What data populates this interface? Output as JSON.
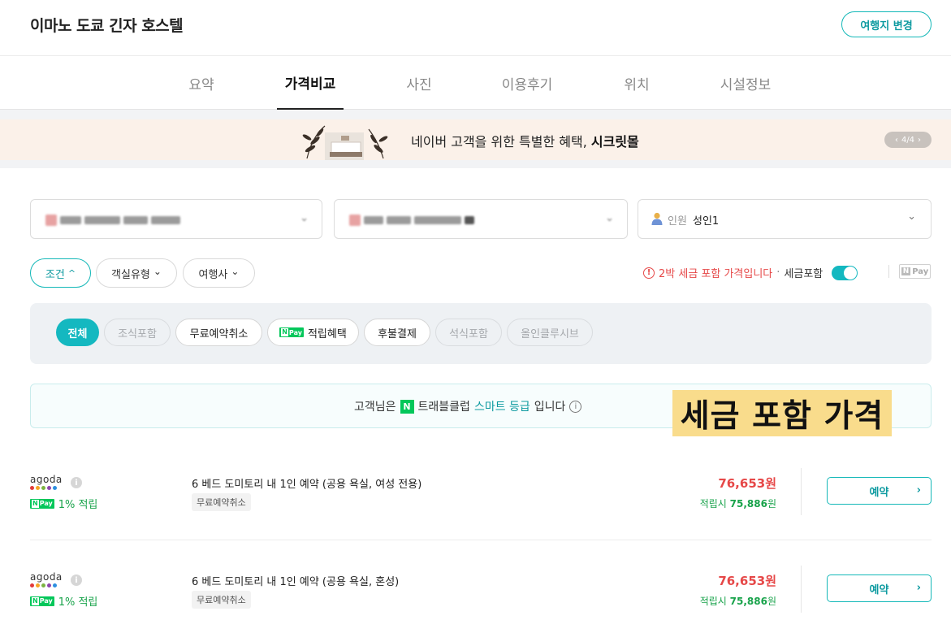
{
  "header": {
    "title": "이마노 도쿄 긴자 호스텔",
    "change_button": "여행지 변경"
  },
  "tabs": [
    {
      "label": "요약"
    },
    {
      "label": "가격비교",
      "active": true
    },
    {
      "label": "사진"
    },
    {
      "label": "이용후기"
    },
    {
      "label": "위치"
    },
    {
      "label": "시설정보"
    }
  ],
  "banner": {
    "text": "네이버 고객을 위한 특별한 혜택, ",
    "highlight": "시크릿몰",
    "pager": "4/4",
    "prev": "‹",
    "next": "›"
  },
  "search": {
    "checkin_value": "",
    "checkout_value": "",
    "guest_label": "인원",
    "guest_value": "성인1",
    "chevron": "⌄"
  },
  "filters": {
    "buttons": [
      {
        "label": "조건",
        "caret": "^",
        "active": true
      },
      {
        "label": "객실유형",
        "caret": "⌄"
      },
      {
        "label": "여행사",
        "caret": "⌄"
      }
    ],
    "notice_icon": "!",
    "notice_text": "2박 세금 포함 가격입니다",
    "separator": "·",
    "tax_toggle_label": "세금포함",
    "tax_toggle_on": true,
    "npay_label": "Pay",
    "npay_n": "N"
  },
  "chips": [
    {
      "label": "전체",
      "state": "on"
    },
    {
      "label": "조식포함",
      "state": "dim"
    },
    {
      "label": "무료예약취소",
      "state": "normal"
    },
    {
      "label": "적립혜택",
      "state": "normal",
      "npay": true
    },
    {
      "label": "후불결제",
      "state": "normal"
    },
    {
      "label": "석식포함",
      "state": "dim"
    },
    {
      "label": "올인클루시브",
      "state": "dim"
    }
  ],
  "npay_mini": {
    "n": "N",
    "pay": "Pay"
  },
  "grade": {
    "prefix": "고객님은",
    "n_icon": "N",
    "club": "트래블클럽",
    "level": "스마트 등급",
    "suffix": "입니다",
    "info": "i"
  },
  "overlay_tag": "세금 포함 가격",
  "offers": [
    {
      "agency": "agoda",
      "info": "i",
      "reward": "1% 적립",
      "room": "6 베드 도미토리 내 1인 예약 (공용 욕실, 여성 전용)",
      "tag": "무료예약취소",
      "price": "76,653원",
      "earn_prefix": "적립시",
      "earn_price": "75,886",
      "earn_unit": "원",
      "book": "예약",
      "arrow": "›"
    },
    {
      "agency": "agoda",
      "info": "i",
      "reward": "1% 적립",
      "room": "6 베드 도미토리 내 1인 예약 (공용 욕실, 혼성)",
      "tag": "무료예약취소",
      "price": "76,653원",
      "earn_prefix": "적립시",
      "earn_price": "75,886",
      "earn_unit": "원",
      "book": "예약",
      "arrow": "›"
    }
  ],
  "colors": {
    "accent": "#14b8c0",
    "price_red": "#e64848",
    "reward_green": "#19a34b",
    "banner_bg": "#fbf1e9",
    "overlay_bg": "#f9dc8c"
  }
}
